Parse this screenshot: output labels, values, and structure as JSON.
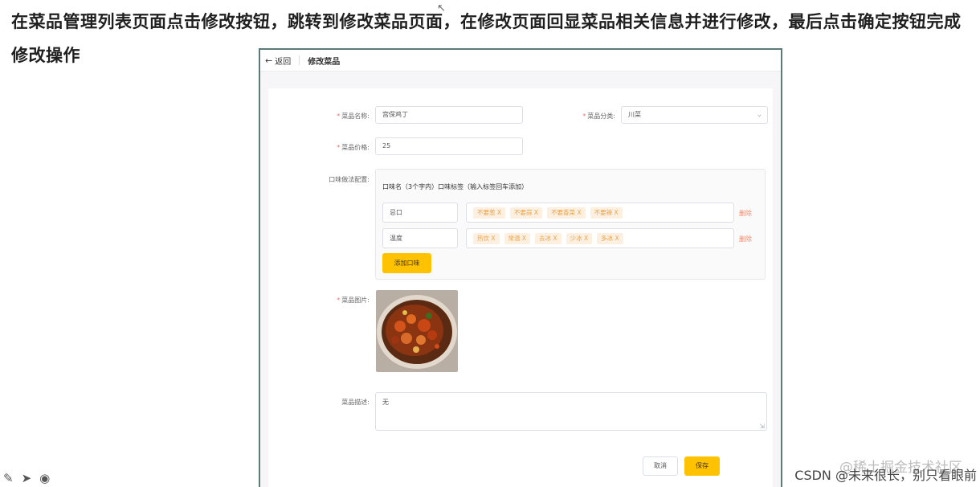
{
  "caption": "在菜品管理列表页面点击修改按钮，跳转到修改菜品页面，在修改页面回显菜品相关信息并进行修改，最后点击确定按钮完成修改操作",
  "header": {
    "back_label": "返回",
    "title": "修改菜品"
  },
  "form": {
    "name_label": "菜品名称:",
    "name_value": "宫保鸡丁",
    "category_label": "菜品分类:",
    "category_value": "川菜",
    "price_label": "菜品价格:",
    "price_value": "25",
    "flavor_label": "口味做法配置:",
    "flavor_header": "口味名（3个字内）口味标签（输入标签回车添加）",
    "flavors": [
      {
        "name": "忌口",
        "tags": [
          "不要葱 X",
          "不要蒜 X",
          "不要香菜 X",
          "不要辣 X"
        ],
        "delete_label": "删除"
      },
      {
        "name": "温度",
        "tags": [
          "热饮 X",
          "常温 X",
          "去冰 X",
          "少冰 X",
          "多冰 X"
        ],
        "delete_label": "删除"
      }
    ],
    "add_flavor_label": "添加口味",
    "image_label": "菜品图片:",
    "desc_label": "菜品描述:",
    "desc_value": "无"
  },
  "actions": {
    "cancel_label": "取消",
    "save_label": "保存"
  },
  "watermarks": {
    "primary": "@稀土掘金技术社区",
    "secondary": "CSDN @未来很长，别只看眼前"
  },
  "colors": {
    "accent": "#ffc200",
    "required": "#f56c6c",
    "tag_text": "#e8a34e",
    "frame_border": "#5d7a77"
  },
  "icons": [
    "pen-icon",
    "pointer-icon",
    "record-icon"
  ]
}
